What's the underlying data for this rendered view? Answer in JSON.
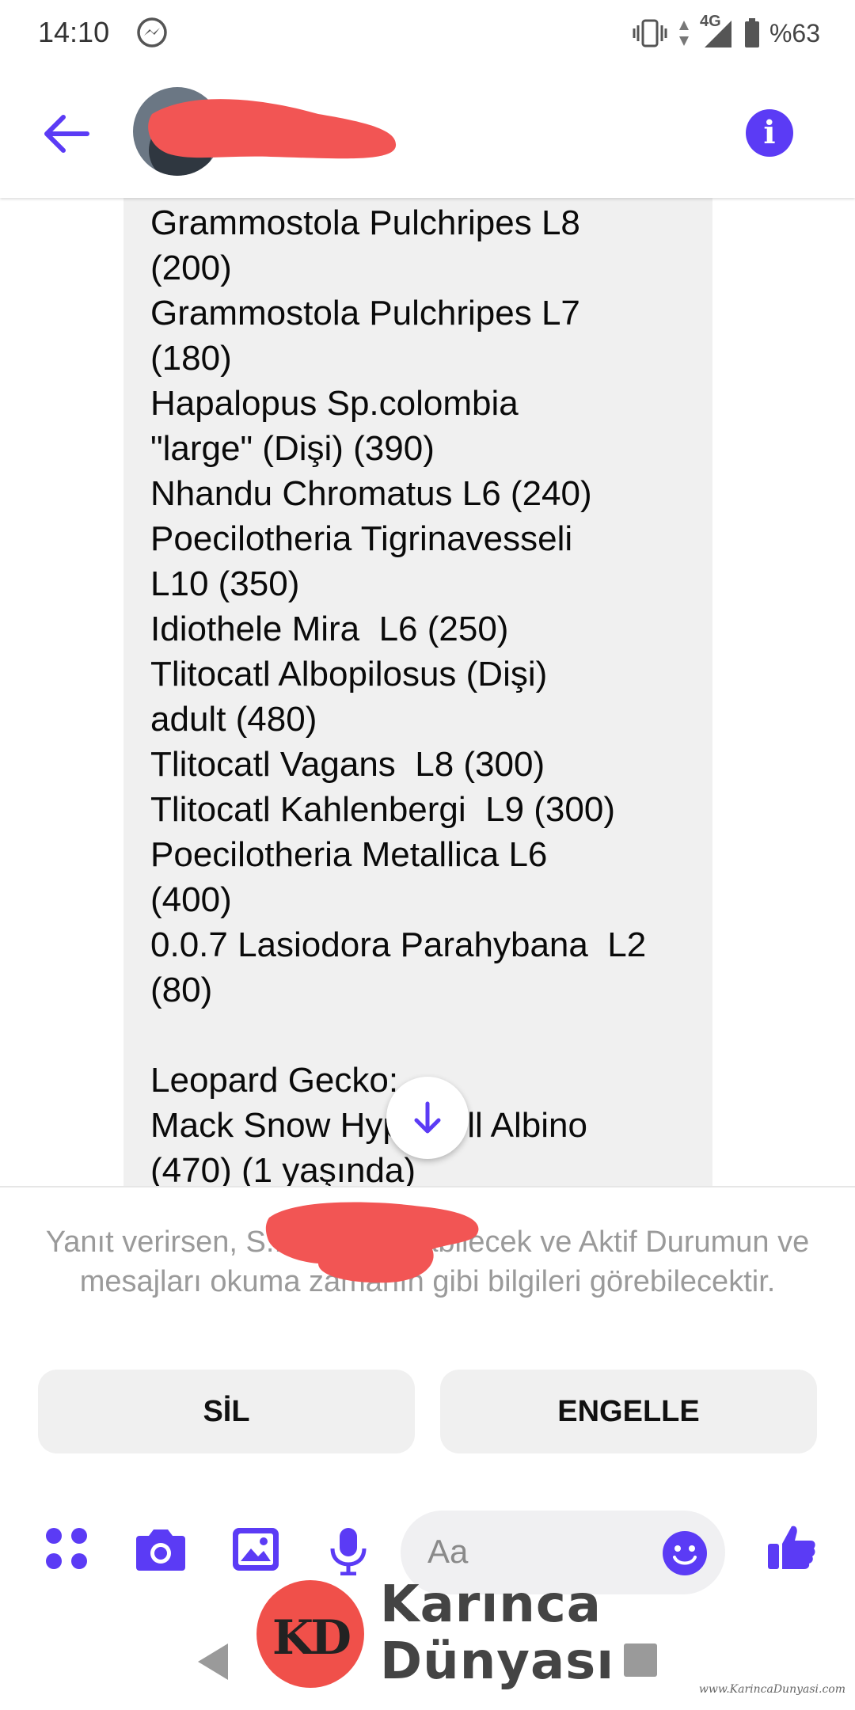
{
  "status_bar": {
    "time": "14:10",
    "network": "4G",
    "battery": "%63"
  },
  "header": {
    "back_icon": "arrow-left-icon",
    "info_icon": "i"
  },
  "message": {
    "top_fragment": "(...)",
    "lines": [
      "Grammostola Pulchripes L8",
      "(200)",
      "Grammostola Pulchripes L7",
      "(180)",
      "Hapalopus Sp.colombia",
      "\"large\" (Dişi) (390)",
      "Nhandu Chromatus L6 (240)",
      "Poecilotheria Tigrinavesseli",
      "L10 (350)",
      "Idiothele Mira  L6 (250)",
      "Tlitocatl Albopilosus (Dişi)",
      "adult (480)",
      "Tlitocatl Vagans  L8 (300)",
      "Tlitocatl Kahlenbergi  L9 (300)",
      "Poecilotheria Metallica L6",
      "(400)",
      "0.0.7 Lasiodora Parahybana  L2",
      "(80)",
      "",
      "Leopard Gecko:",
      "Mack Snow Hypo Tell Albino",
      "(470) (1 yaşında)"
    ]
  },
  "request": {
    "text": "Yanıt verirsen, S... seni arayabilecek ve Aktif Durumun ve mesajları okuma zamanın gibi bilgileri görebilecektir.",
    "delete_label": "SİL",
    "block_label": "ENGELLE"
  },
  "composer": {
    "placeholder": "Aa"
  },
  "watermark": {
    "line1": "Karınca",
    "line2": "Dünyası",
    "initials": "KD",
    "url": "www.KarincaDunyasi.com"
  },
  "colors": {
    "accent": "#5b3bf5",
    "redaction": "#f25554",
    "bubble": "#f0f0f0"
  }
}
